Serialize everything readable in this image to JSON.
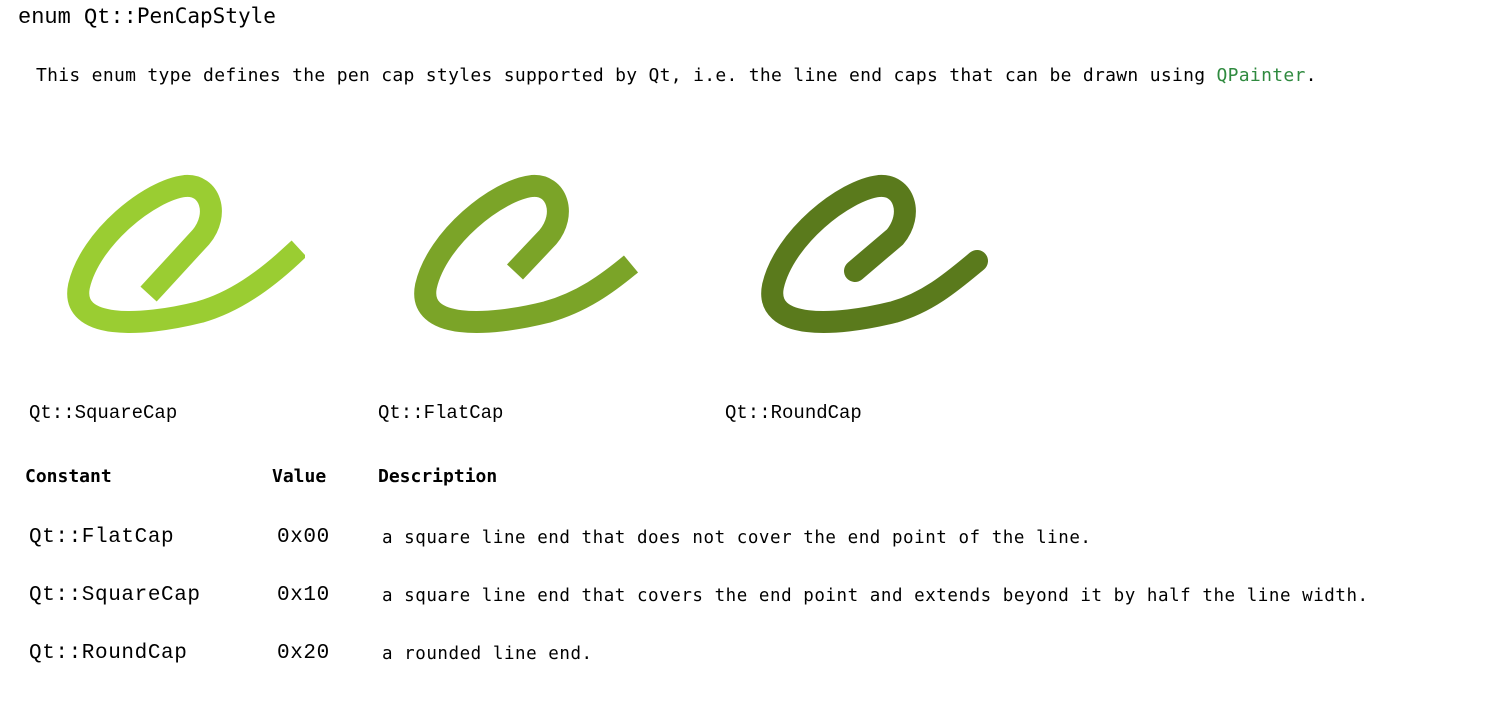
{
  "title": {
    "prefix": "enum Qt::",
    "name": "PenCapStyle"
  },
  "intro": {
    "text": "This enum type defines the pen cap styles supported by Qt, i.e. the line end caps that can be drawn using ",
    "link": "QPainter",
    "suffix": "."
  },
  "figures": [
    {
      "label": "Qt::SquareCap",
      "color": "#9acd32",
      "cap": "square"
    },
    {
      "label": "Qt::FlatCap",
      "color": "#7ba428",
      "cap": "flat"
    },
    {
      "label": "Qt::RoundCap",
      "color": "#5a7a1c",
      "cap": "round"
    }
  ],
  "table": {
    "headers": [
      "Constant",
      "Value",
      "Description"
    ],
    "rows": [
      {
        "constant": "Qt::FlatCap",
        "value": "0x00",
        "description": "a square line end that does not cover the end point of the line."
      },
      {
        "constant": "Qt::SquareCap",
        "value": "0x10",
        "description": "a square line end that covers the end point and extends beyond it by half the line width."
      },
      {
        "constant": "Qt::RoundCap",
        "value": "0x20",
        "description": "a rounded line end."
      }
    ]
  },
  "colors": {
    "link": "#2f8a3f",
    "text": "#000000",
    "background": "#ffffff"
  }
}
